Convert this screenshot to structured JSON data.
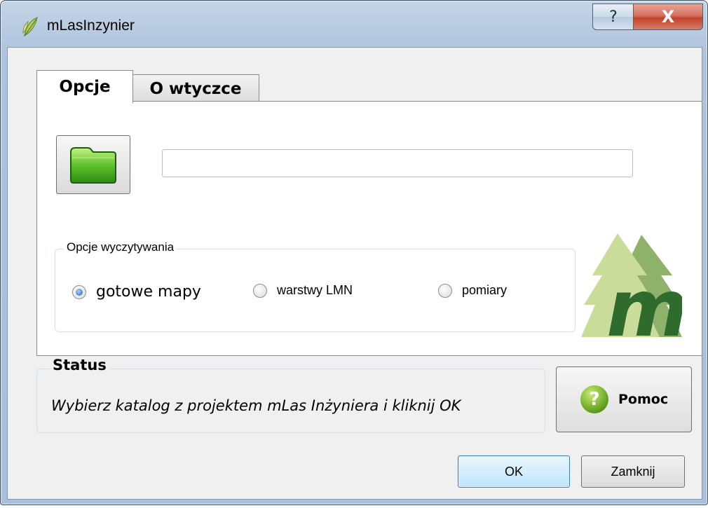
{
  "window": {
    "title": "mLasInzynier",
    "help_glyph": "?",
    "close_glyph": "X"
  },
  "tabs": [
    {
      "label": "Opcje",
      "active": true
    },
    {
      "label": "O wtyczce",
      "active": false
    }
  ],
  "options_tab": {
    "folder_button_icon": "folder-icon",
    "path_input": {
      "value": "",
      "placeholder": ""
    },
    "read_options": {
      "title": "Opcje wyczytywania",
      "radios": [
        {
          "label": "gotowe mapy",
          "checked": true
        },
        {
          "label": "warstwy LMN",
          "checked": false
        },
        {
          "label": "pomiary",
          "checked": false
        }
      ]
    },
    "logo_text": "m"
  },
  "status": {
    "title": "Status",
    "message": "Wybierz katalog z projektem mLas Inżyniera i kliknij OK"
  },
  "buttons": {
    "help_icon_glyph": "?",
    "help_label": "Pomoc",
    "ok_label": "OK",
    "close_label": "Zamknij"
  },
  "colors": {
    "logo_dark_green": "#2f6b2c",
    "logo_tree_light": "#c9dc9a",
    "logo_tree_mid": "#8fb26a",
    "folder_green": "#5cc22c",
    "close_red": "#c4402a"
  }
}
